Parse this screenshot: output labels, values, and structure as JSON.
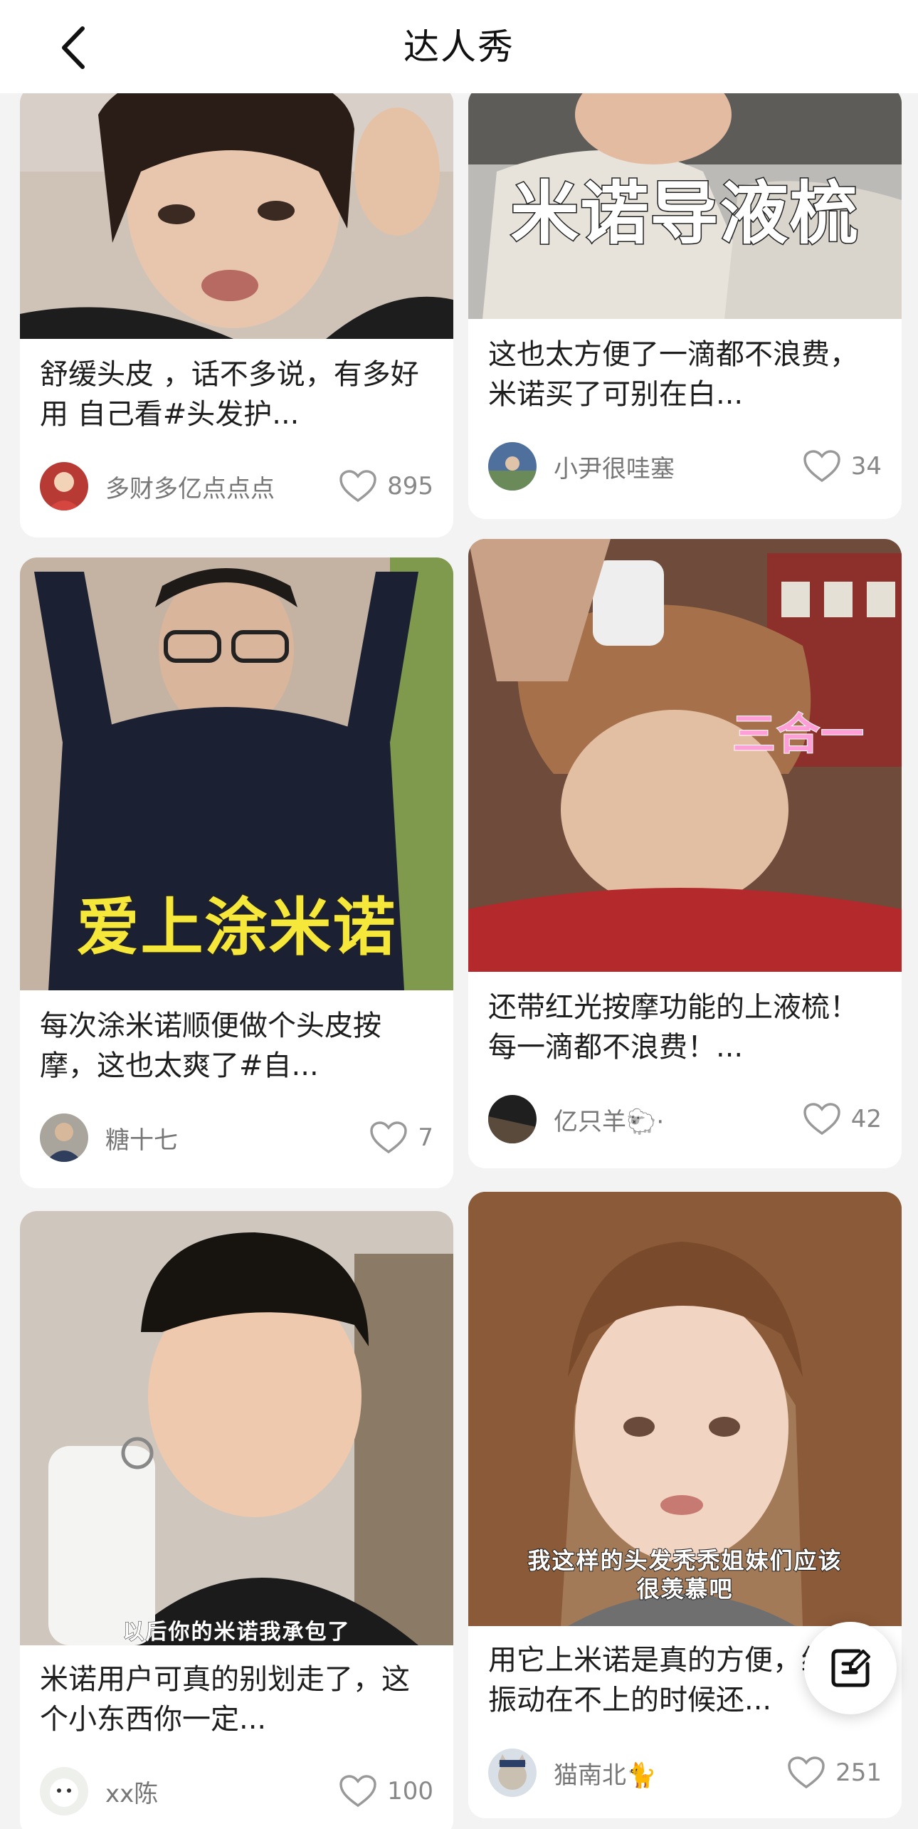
{
  "header": {
    "title": "达人秀",
    "back_icon": "chevron-left-icon"
  },
  "posts": [
    {
      "caption": "舒缓头皮 ，话不多说，有多好用 自己看#头发护...",
      "author": "多财多亿点点点",
      "likes": "895",
      "overlay": ""
    },
    {
      "caption": "这也太方便了一滴都不浪费，米诺买了可别在白...",
      "author": "小尹很哇塞",
      "likes": "34",
      "overlay": "米诺导液梳"
    },
    {
      "caption": "每次涂米诺顺便做个头皮按摩，这也太爽了#自...",
      "author": "糖十七",
      "likes": "7",
      "overlay": "爱上涂米诺"
    },
    {
      "caption": "还带红光按摩功能的上液梳！每一滴都不浪费！...",
      "author": "亿只羊🐑·",
      "likes": "42",
      "overlay": "三合一"
    },
    {
      "caption": "米诺用户可真的别划走了，这个小东西你一定...",
      "author": "xx陈",
      "likes": "100",
      "overlay": "以后你的米诺我承包了"
    },
    {
      "caption": "用它上米诺是真的方便，红光振动在不上的时候还...",
      "author": "猫南北🐈",
      "likes": "251",
      "overlay": "我这样的头发秃秃姐妹们应该很羡慕吧"
    }
  ],
  "fab": {
    "icon": "edit-note-icon"
  },
  "like_icon": "heart-outline-icon"
}
